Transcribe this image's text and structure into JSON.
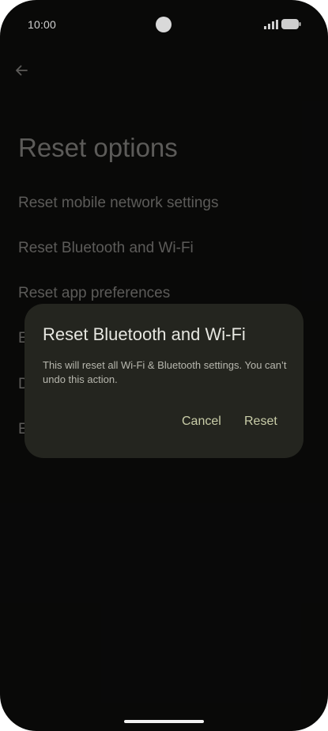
{
  "status_bar": {
    "time": "10:00"
  },
  "header": {
    "title": "Reset options",
    "back_icon": "arrow-left-icon"
  },
  "options": [
    {
      "label": "Reset mobile network settings"
    },
    {
      "label": "Reset Bluetooth and Wi-Fi"
    },
    {
      "label": "Reset app preferences"
    },
    {
      "label": "E"
    },
    {
      "label": "D"
    },
    {
      "label": "E"
    }
  ],
  "dialog": {
    "title": "Reset Bluetooth and Wi-Fi",
    "body": "This will reset all Wi-Fi & Bluetooth settings. You can’t undo this action.",
    "cancel_label": "Cancel",
    "confirm_label": "Reset",
    "accent_color": "#c9cda8"
  }
}
